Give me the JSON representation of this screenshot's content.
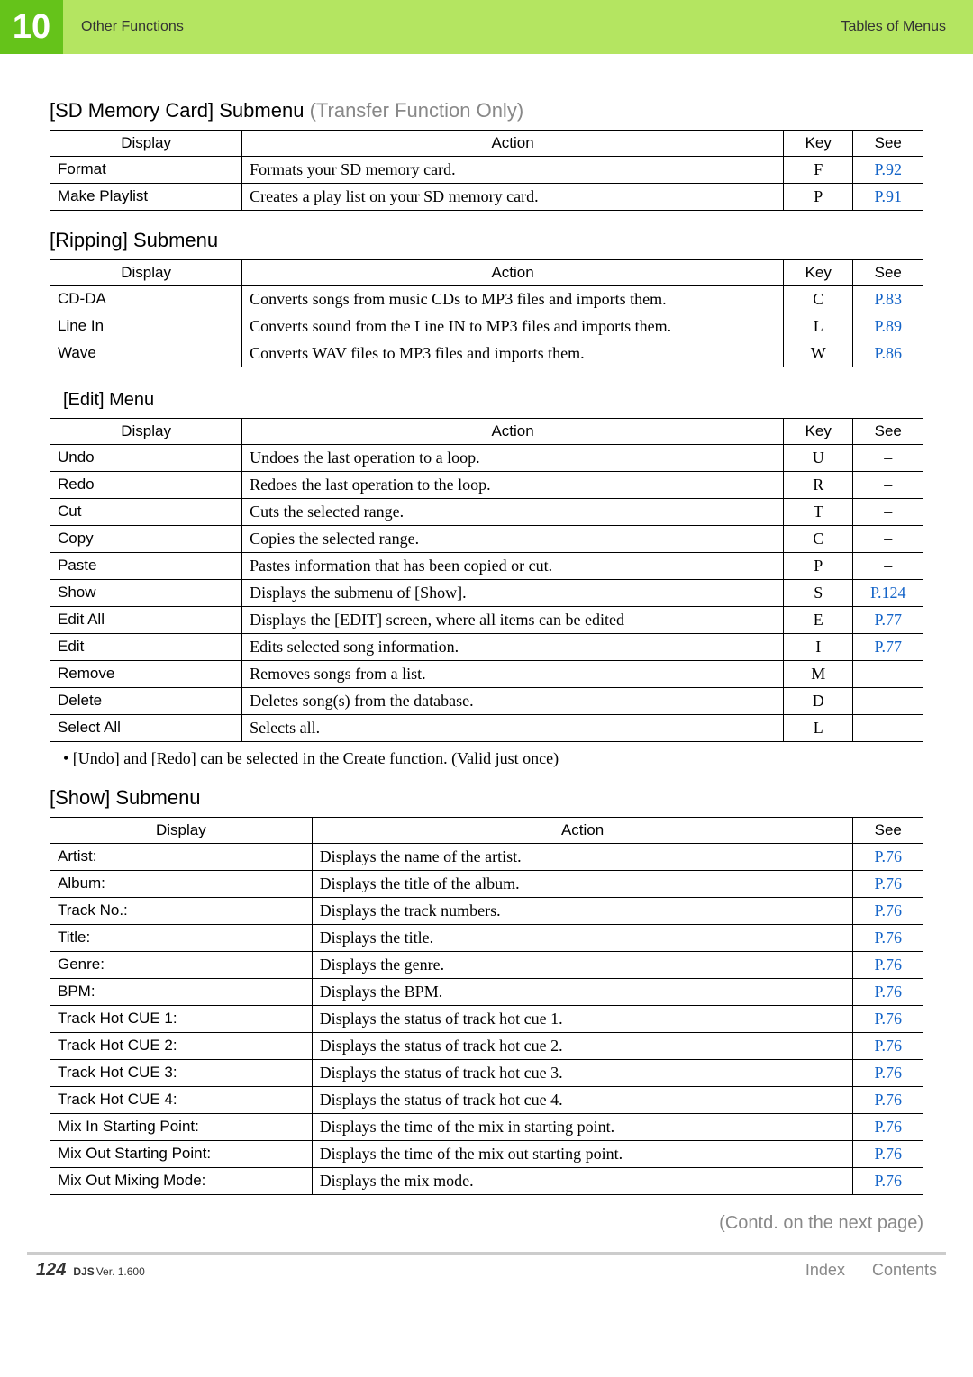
{
  "header": {
    "chapter_number": "10",
    "chapter_title": "Other Functions",
    "section": "Tables of Menus"
  },
  "sd_submenu": {
    "title_main": "[SD Memory Card] Submenu",
    "title_paren": "(Transfer Function Only)",
    "headers": [
      "Display",
      "Action",
      "Key",
      "See"
    ],
    "rows": [
      {
        "display": "Format",
        "action": "Formats your SD memory card.",
        "key": "F",
        "see": "P.92"
      },
      {
        "display": "Make Playlist",
        "action": "Creates a play list on your SD memory card.",
        "key": "P",
        "see": "P.91"
      }
    ]
  },
  "ripping": {
    "title": "[Ripping] Submenu",
    "headers": [
      "Display",
      "Action",
      "Key",
      "See"
    ],
    "rows": [
      {
        "display": "CD-DA",
        "action": "Converts songs from music CDs to MP3 files and imports them.",
        "key": "C",
        "see": "P.83"
      },
      {
        "display": "Line In",
        "action": "Converts sound from the Line IN to MP3 files and imports them.",
        "key": "L",
        "see": "P.89"
      },
      {
        "display": "Wave",
        "action": "Converts WAV files to MP3 files and imports them.",
        "key": "W",
        "see": "P.86"
      }
    ]
  },
  "edit": {
    "title": "[Edit] Menu",
    "headers": [
      "Display",
      "Action",
      "Key",
      "See"
    ],
    "rows": [
      {
        "display": "Undo",
        "action": "Undoes the last operation to a loop.",
        "key": "U",
        "see": "–"
      },
      {
        "display": "Redo",
        "action": "Redoes the last operation to the loop.",
        "key": "R",
        "see": "–"
      },
      {
        "display": "Cut",
        "action": "Cuts the selected range.",
        "key": "T",
        "see": "–"
      },
      {
        "display": "Copy",
        "action": "Copies the selected range.",
        "key": "C",
        "see": "–"
      },
      {
        "display": "Paste",
        "action": "Pastes information that has been copied or cut.",
        "key": "P",
        "see": "–"
      },
      {
        "display": "Show",
        "action": "Displays the submenu of [Show].",
        "key": "S",
        "see": "P.124"
      },
      {
        "display": "Edit All",
        "action": "Displays the [EDIT]  screen, where all items can be edited",
        "key": "E",
        "see": "P.77"
      },
      {
        "display": "Edit",
        "action": "Edits selected song information.",
        "key": "I",
        "see": "P.77"
      },
      {
        "display": "Remove",
        "action": "Removes songs from a list.",
        "key": "M",
        "see": "–"
      },
      {
        "display": "Delete",
        "action": "Deletes song(s) from the database.",
        "key": "D",
        "see": "–"
      },
      {
        "display": "Select All",
        "action": "Selects all.",
        "key": "L",
        "see": "–"
      }
    ],
    "note": "• [Undo] and [Redo] can be selected in the Create function. (Valid just once)"
  },
  "show": {
    "title": "[Show] Submenu",
    "headers": [
      "Display",
      "Action",
      "See"
    ],
    "rows": [
      {
        "display": "Artist:",
        "action": "Displays the name of the artist.",
        "see": "P.76"
      },
      {
        "display": "Album:",
        "action": "Displays the title of the album.",
        "see": "P.76"
      },
      {
        "display": "Track No.:",
        "action": "Displays the track numbers.",
        "see": "P.76"
      },
      {
        "display": "Title:",
        "action": "Displays the title.",
        "see": "P.76"
      },
      {
        "display": "Genre:",
        "action": "Displays the genre.",
        "see": "P.76"
      },
      {
        "display": "BPM:",
        "action": "Displays the BPM.",
        "see": "P.76"
      },
      {
        "display": "Track Hot CUE 1:",
        "action": "Displays the status of track hot cue 1.",
        "see": "P.76"
      },
      {
        "display": "Track Hot CUE 2:",
        "action": "Displays the status of track hot cue 2.",
        "see": "P.76"
      },
      {
        "display": "Track Hot CUE 3:",
        "action": "Displays the status of track hot cue 3.",
        "see": "P.76"
      },
      {
        "display": "Track Hot CUE 4:",
        "action": "Displays the status of track hot cue 4.",
        "see": "P.76"
      },
      {
        "display": "Mix In Starting Point:",
        "action": "Displays the time of the mix in starting point.",
        "see": "P.76"
      },
      {
        "display": "Mix Out Starting Point:",
        "action": "Displays the time of the mix out starting point.",
        "see": "P.76"
      },
      {
        "display": "Mix Out Mixing Mode:",
        "action": "Displays the mix mode.",
        "see": "P.76"
      }
    ]
  },
  "contd": "(Contd. on the next page)",
  "footer": {
    "page": "124",
    "djs": "DJS",
    "ver": "Ver. 1.600",
    "index": "Index",
    "contents": "Contents"
  }
}
